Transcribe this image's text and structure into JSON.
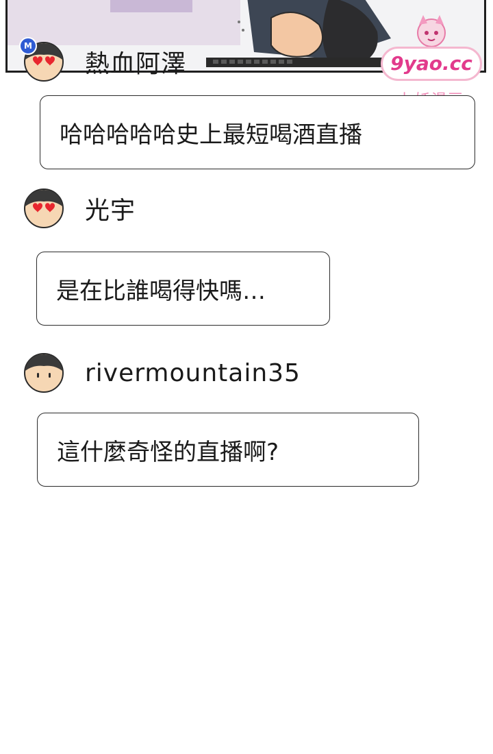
{
  "watermark": {
    "logo_text": "9yao.cc",
    "subtitle": "九妖漫画"
  },
  "comments": [
    {
      "username": "熱血阿澤",
      "badge": "M",
      "avatar": "heart-eyes-avatar",
      "message": "哈哈哈哈哈史上最短喝酒直播"
    },
    {
      "username": "光宇",
      "avatar": "heart-eyes-avatar",
      "message": "是在比誰喝得快嗎…"
    },
    {
      "username": "rivermountain35",
      "avatar": "plain-avatar",
      "message": "這什麼奇怪的直播啊?"
    }
  ],
  "colors": {
    "heart": "#e8262e",
    "avatar_face": "#f6d7b4",
    "avatar_hair": "#3a3a3a",
    "badge": "#2f5bd3",
    "watermark_pink": "#e23a8c"
  }
}
